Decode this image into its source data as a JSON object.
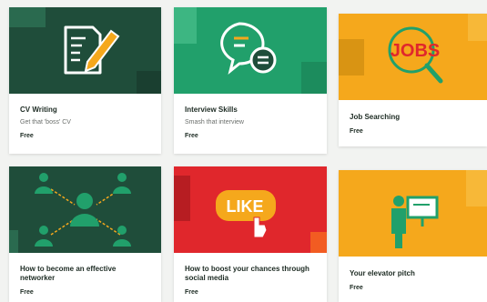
{
  "courses": [
    {
      "title": "CV Writing",
      "subtitle": "Get that 'boss' CV",
      "price": "Free",
      "icon": "cv-document-pen-icon",
      "bg": "#1f4d3a"
    },
    {
      "title": "Interview Skills",
      "subtitle": "Smash that interview",
      "price": "Free",
      "icon": "speech-bubbles-icon",
      "bg": "#21a06b"
    },
    {
      "title": "Job Searching",
      "subtitle": "",
      "price": "Free",
      "icon": "jobs-magnifier-icon",
      "bg": "#f5a81c",
      "image_text": "JOBS"
    },
    {
      "title": "How to become an effective networker",
      "subtitle": "",
      "price": "Free",
      "icon": "network-people-icon",
      "bg": "#1f4d3a"
    },
    {
      "title": "How to boost your chances through social media",
      "subtitle": "",
      "price": "Free",
      "icon": "like-hand-icon",
      "bg": "#e0272c",
      "image_text": "LIKE"
    },
    {
      "title": "Your elevator pitch",
      "subtitle": "",
      "price": "Free",
      "icon": "presenter-board-icon",
      "bg": "#f5a81c"
    }
  ]
}
